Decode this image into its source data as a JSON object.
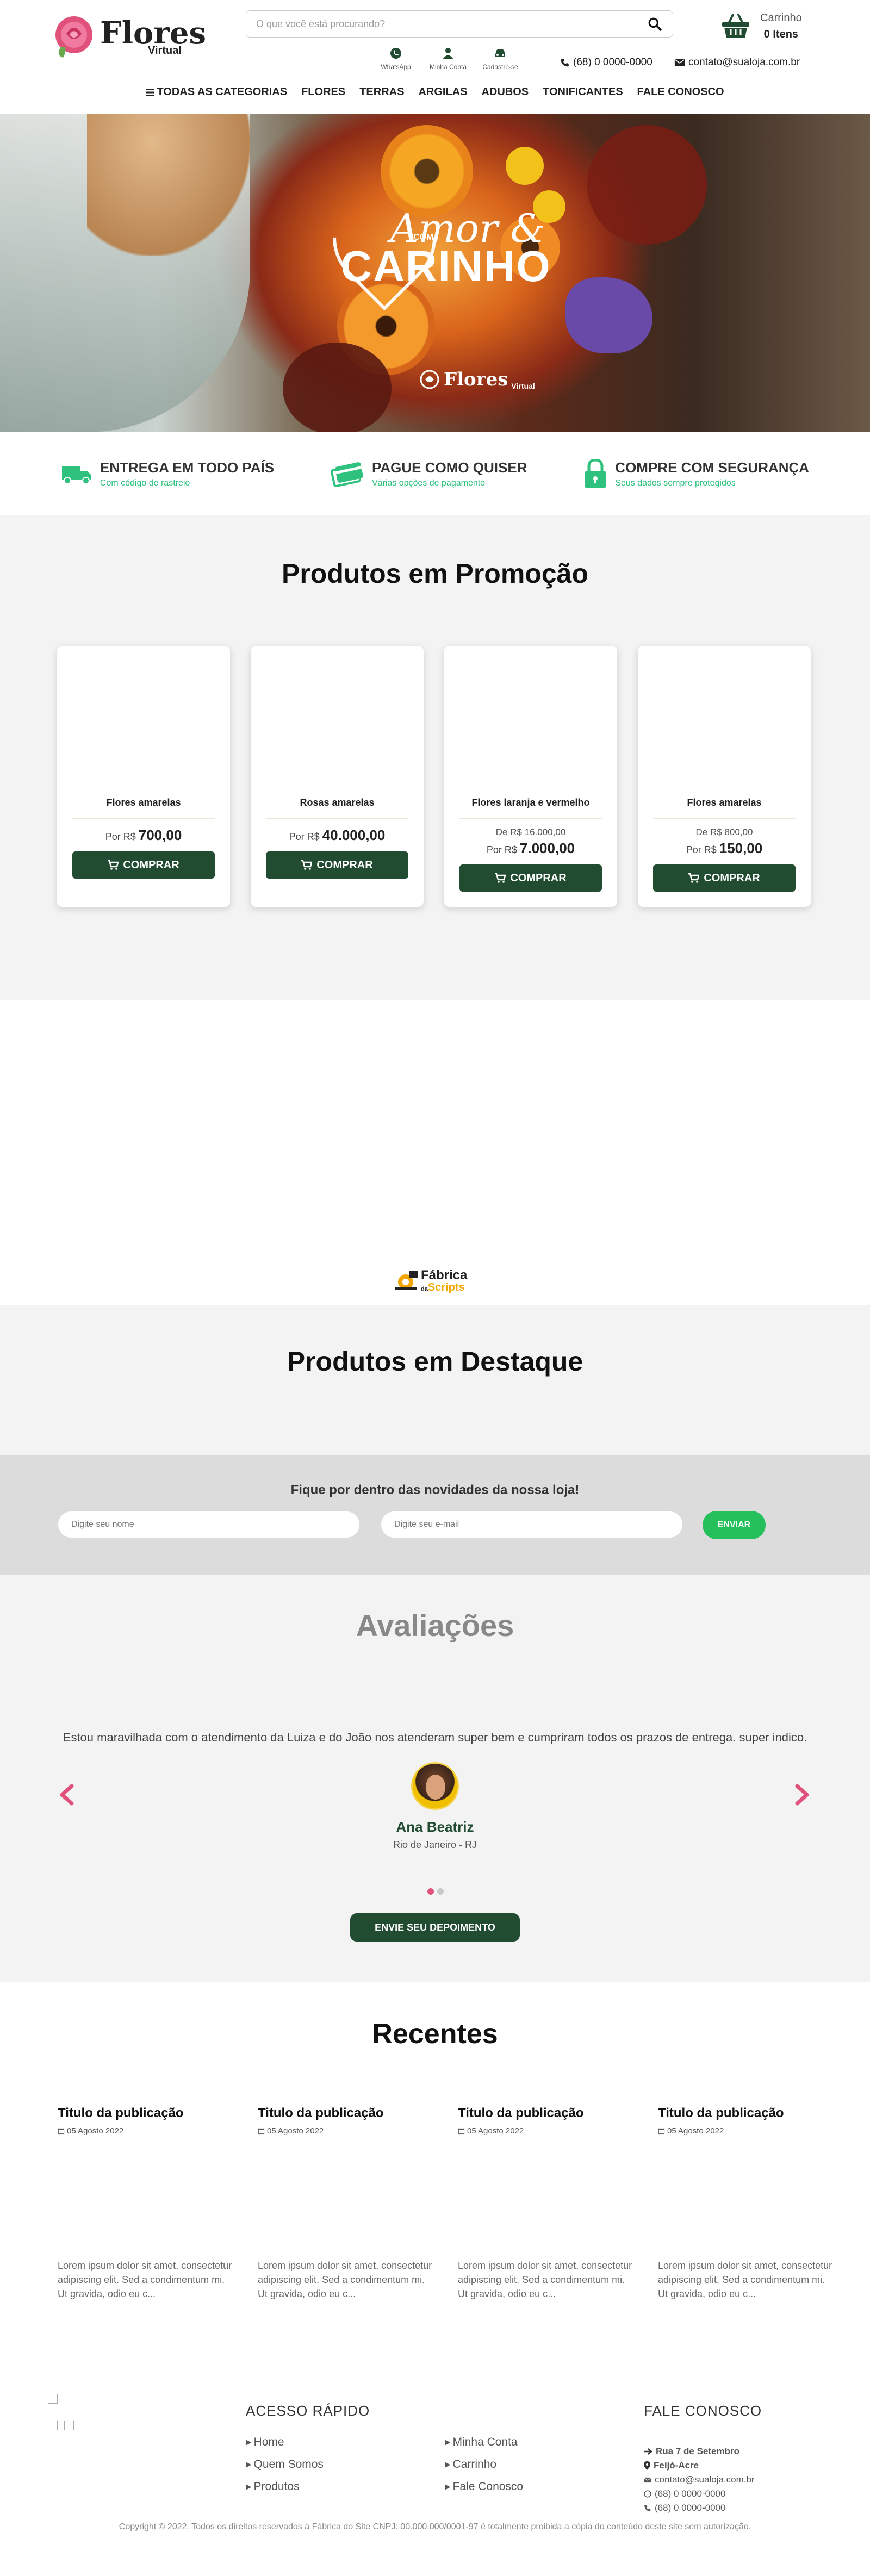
{
  "header": {
    "logo_title": "Flores",
    "logo_subtitle": "Virtual",
    "search_placeholder": "O que você está procurando?",
    "cart_label": "Carrinho",
    "cart_count": "0 Itens",
    "quick_links": [
      {
        "label": "WhatsApp",
        "icon": "whatsapp-icon"
      },
      {
        "label": "Minha Conta",
        "icon": "user-icon"
      },
      {
        "label": "Cadastre-se",
        "icon": "car-icon"
      }
    ],
    "phone": "(68) 0 0000-0000",
    "email": "contato@sualoja.com.br",
    "nav": [
      "TODAS AS CATEGORIAS",
      "FLORES",
      "TERRAS",
      "ARGILAS",
      "ADUBOS",
      "TONIFICANTES",
      "FALE CONOSCO"
    ]
  },
  "hero": {
    "small": "COM",
    "script": "Amor &",
    "big": "CARINHO",
    "badge_title": "Flores",
    "badge_sub": "Virtual"
  },
  "benefits": [
    {
      "title": "ENTREGA EM TODO PAÍS",
      "subtitle": "Com código de rastreio",
      "icon": "truck-icon"
    },
    {
      "title": "PAGUE COMO QUISER",
      "subtitle": "Várias opções de pagamento",
      "icon": "credit-card-icon"
    },
    {
      "title": "COMPRE COM SEGURANÇA",
      "subtitle": "Seus dados sempre protegidos",
      "icon": "lock-icon"
    }
  ],
  "promo": {
    "title_normal": "Produtos em ",
    "title_bold": "Promoção",
    "buy_label": "COMPRAR",
    "price_prefix": "Por R$",
    "old_prefix": "De R$",
    "products": [
      {
        "name": "Flores amarelas",
        "old_price": "",
        "price": "700,00"
      },
      {
        "name": "Rosas amarelas",
        "old_price": "",
        "price": "40.000,00"
      },
      {
        "name": "Flores laranja e vermelho",
        "old_price": "16.000,00",
        "price": "7.000,00"
      },
      {
        "name": "Flores amarelas",
        "old_price": "800,00",
        "price": "150,00"
      }
    ]
  },
  "partner": {
    "line1": "Fábrica",
    "line2": "Scripts",
    "small": "da"
  },
  "destaque": {
    "title_normal": "Produtos em ",
    "title_bold": "Destaque"
  },
  "newsletter": {
    "title": "Fique por dentro das novidades da nossa loja!",
    "name_placeholder": "Digite seu nome",
    "email_placeholder": "Digite seu e-mail",
    "send_label": "ENVIAR"
  },
  "reviews": {
    "title": "Avaliações",
    "quote": "Estou maravilhada com o atendimento da Luiza e do João nos atenderam super bem e cumpriram todos os prazos de entrega. super indico.",
    "name": "Ana Beatriz",
    "city": "Rio de Janeiro - RJ",
    "button": "ENVIE SEU DEPOIMENTO",
    "slides": 2,
    "active_slide": 1,
    "accent": "#e0527c"
  },
  "recent": {
    "title": "Recentes",
    "posts": [
      {
        "title": "Titulo da publicação",
        "date": "05 Agosto 2022",
        "excerpt": "Lorem ipsum dolor sit amet, consectetur adipiscing elit. Sed a condimentum mi. Ut gravida, odio eu c..."
      },
      {
        "title": "Titulo da publicação",
        "date": "05 Agosto 2022",
        "excerpt": "Lorem ipsum dolor sit amet, consectetur adipiscing elit. Sed a condimentum mi. Ut gravida, odio eu c..."
      },
      {
        "title": "Titulo da publicação",
        "date": "05 Agosto 2022",
        "excerpt": "Lorem ipsum dolor sit amet, consectetur adipiscing elit. Sed a condimentum mi. Ut gravida, odio eu c..."
      },
      {
        "title": "Titulo da publicação",
        "date": "05 Agosto 2022",
        "excerpt": "Lorem ipsum dolor sit amet, consectetur adipiscing elit. Sed a condimentum mi. Ut gravida, odio eu c..."
      }
    ]
  },
  "footer": {
    "quick_title": "ACESSO RÁPIDO",
    "links_col1": [
      "Home",
      "Quem Somos",
      "Produtos"
    ],
    "links_col2": [
      "Minha Conta",
      "Carrinho",
      "Fale Conosco"
    ],
    "contact_title": "FALE CONOSCO",
    "address_line1": "Rua 7 de Setembro",
    "address_line2": "Feijó-Acre",
    "email": "contato@sualoja.com.br",
    "whatsapp": "(68) 0 0000-0000",
    "phone": "(68) 0 0000-0000",
    "copyright": "Copyright © 2022. Todos os direitos reservados à Fábrica do Site CNPJ: 00.000.000/0001-97 é totalmente proibida a cópia do conteúdo deste site sem autorização."
  },
  "colors": {
    "primary": "#224c32",
    "accent_green": "#25c05c",
    "pink": "#e0527c"
  }
}
